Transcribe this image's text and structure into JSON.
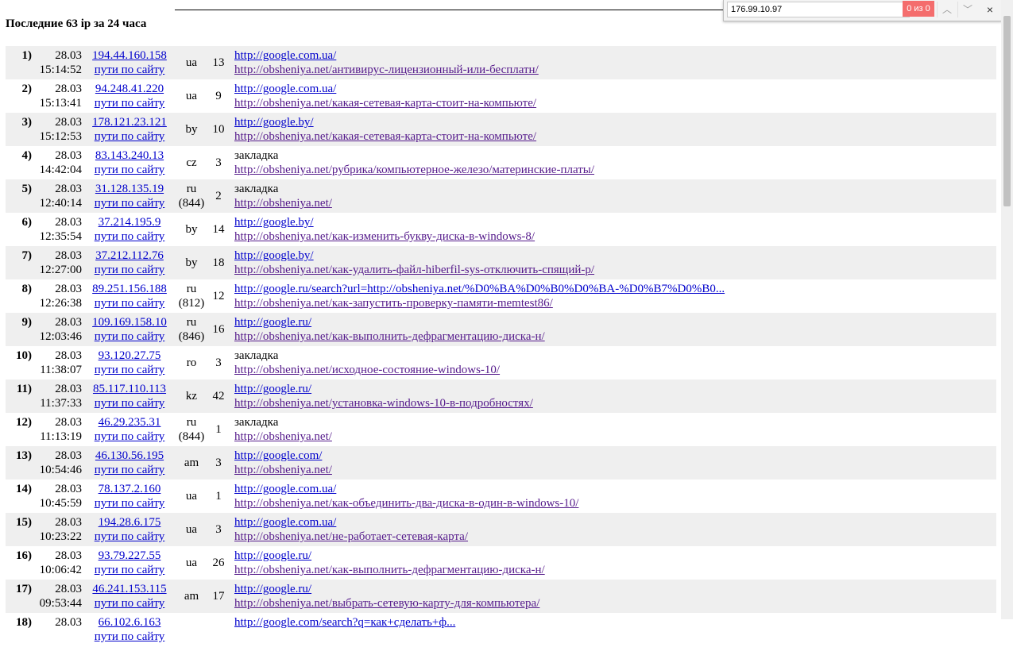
{
  "heading": "Последние 63 ip за 24 часа",
  "path_label": "пути по сайту",
  "find": {
    "query": "176.99.10.97",
    "count": "0 из 0",
    "up_icon": "chevron-up-icon",
    "down_icon": "chevron-down-icon",
    "close_icon": "close-icon",
    "close_glyph": "×",
    "up_glyph": "︿",
    "down_glyph": "﹀",
    "count_bg": "#f46d6d"
  },
  "colors": {
    "link": "#0000cc",
    "row_alt": "#efefef"
  },
  "rows": [
    {
      "num": "1)",
      "date": "28.03",
      "time": "15:14:52",
      "ip": "194.44.160.158",
      "cc": "ua",
      "cc2": "",
      "count": "13",
      "ref": "http://google.com.ua/",
      "ref_link": true,
      "page": "http://obsheniya.net/антивирус-лицензионный-или-бесплатн/"
    },
    {
      "num": "2)",
      "date": "28.03",
      "time": "15:13:41",
      "ip": "94.248.41.220",
      "cc": "ua",
      "cc2": "",
      "count": "9",
      "ref": "http://google.com.ua/",
      "ref_link": true,
      "page": "http://obsheniya.net/какая-сетевая-карта-стоит-на-компьюте/"
    },
    {
      "num": "3)",
      "date": "28.03",
      "time": "15:12:53",
      "ip": "178.121.23.121",
      "cc": "by",
      "cc2": "",
      "count": "10",
      "ref": "http://google.by/",
      "ref_link": true,
      "page": "http://obsheniya.net/какая-сетевая-карта-стоит-на-компьюте/"
    },
    {
      "num": "4)",
      "date": "28.03",
      "time": "14:42:04",
      "ip": "83.143.240.13",
      "cc": "cz",
      "cc2": "",
      "count": "3",
      "ref": "закладка",
      "ref_link": false,
      "page": "http://obsheniya.net/рубрика/компьютерное-железо/материнские-платы/"
    },
    {
      "num": "5)",
      "date": "28.03",
      "time": "12:40:14",
      "ip": "31.128.135.19",
      "cc": "ru",
      "cc2": "(844)",
      "count": "2",
      "ref": "закладка",
      "ref_link": false,
      "page": "http://obsheniya.net/"
    },
    {
      "num": "6)",
      "date": "28.03",
      "time": "12:35:54",
      "ip": "37.214.195.9",
      "cc": "by",
      "cc2": "",
      "count": "14",
      "ref": "http://google.by/",
      "ref_link": true,
      "page": "http://obsheniya.net/как-изменить-букву-диска-в-windows-8/"
    },
    {
      "num": "7)",
      "date": "28.03",
      "time": "12:27:00",
      "ip": "37.212.112.76",
      "cc": "by",
      "cc2": "",
      "count": "18",
      "ref": "http://google.by/",
      "ref_link": true,
      "page": "http://obsheniya.net/как-удалить-файл-hiberfil-sys-отключить-спящий-р/"
    },
    {
      "num": "8)",
      "date": "28.03",
      "time": "12:26:38",
      "ip": "89.251.156.188",
      "cc": "ru",
      "cc2": "(812)",
      "count": "12",
      "ref": "http://google.ru/search?url=http://obsheniya.net/%D0%BA%D0%B0%D0%BA-%D0%B7%D0%B0...",
      "ref_link": true,
      "page": "http://obsheniya.net/как-запустить-проверку-памяти-memtest86/"
    },
    {
      "num": "9)",
      "date": "28.03",
      "time": "12:03:46",
      "ip": "109.169.158.10",
      "cc": "ru",
      "cc2": "(846)",
      "count": "16",
      "ref": "http://google.ru/",
      "ref_link": true,
      "page": "http://obsheniya.net/как-выполнить-дефрагментацию-диска-н/"
    },
    {
      "num": "10)",
      "date": "28.03",
      "time": "11:38:07",
      "ip": "93.120.27.75",
      "cc": "ro",
      "cc2": "",
      "count": "3",
      "ref": "закладка",
      "ref_link": false,
      "page": "http://obsheniya.net/исходное-состояние-windows-10/"
    },
    {
      "num": "11)",
      "date": "28.03",
      "time": "11:37:33",
      "ip": "85.117.110.113",
      "cc": "kz",
      "cc2": "",
      "count": "42",
      "ref": "http://google.ru/",
      "ref_link": true,
      "page": "http://obsheniya.net/установка-windows-10-в-подробностях/"
    },
    {
      "num": "12)",
      "date": "28.03",
      "time": "11:13:19",
      "ip": "46.29.235.31",
      "cc": "ru",
      "cc2": "(844)",
      "count": "1",
      "ref": "закладка",
      "ref_link": false,
      "page": "http://obsheniya.net/"
    },
    {
      "num": "13)",
      "date": "28.03",
      "time": "10:54:46",
      "ip": "46.130.56.195",
      "cc": "am",
      "cc2": "",
      "count": "3",
      "ref": "http://google.com/",
      "ref_link": true,
      "page": "http://obsheniya.net/"
    },
    {
      "num": "14)",
      "date": "28.03",
      "time": "10:45:59",
      "ip": "78.137.2.160",
      "cc": "ua",
      "cc2": "",
      "count": "1",
      "ref": "http://google.com.ua/",
      "ref_link": true,
      "page": "http://obsheniya.net/как-объединить-два-диска-в-один-в-windows-10/"
    },
    {
      "num": "15)",
      "date": "28.03",
      "time": "10:23:22",
      "ip": "194.28.6.175",
      "cc": "ua",
      "cc2": "",
      "count": "3",
      "ref": "http://google.com.ua/",
      "ref_link": true,
      "page": "http://obsheniya.net/не-работает-сетевая-карта/"
    },
    {
      "num": "16)",
      "date": "28.03",
      "time": "10:06:42",
      "ip": "93.79.227.55",
      "cc": "ua",
      "cc2": "",
      "count": "26",
      "ref": "http://google.ru/",
      "ref_link": true,
      "page": "http://obsheniya.net/как-выполнить-дефрагментацию-диска-н/"
    },
    {
      "num": "17)",
      "date": "28.03",
      "time": "09:53:44",
      "ip": "46.241.153.115",
      "cc": "am",
      "cc2": "",
      "count": "17",
      "ref": "http://google.ru/",
      "ref_link": true,
      "page": "http://obsheniya.net/выбрать-сетевую-карту-для-компьютера/"
    },
    {
      "num": "18)",
      "date": "28.03",
      "time": "",
      "ip": "66.102.6.163",
      "cc": "",
      "cc2": "",
      "count": "",
      "ref": "http://google.com/search?q=как+сделать+ф...",
      "ref_link": true,
      "page": ""
    }
  ]
}
